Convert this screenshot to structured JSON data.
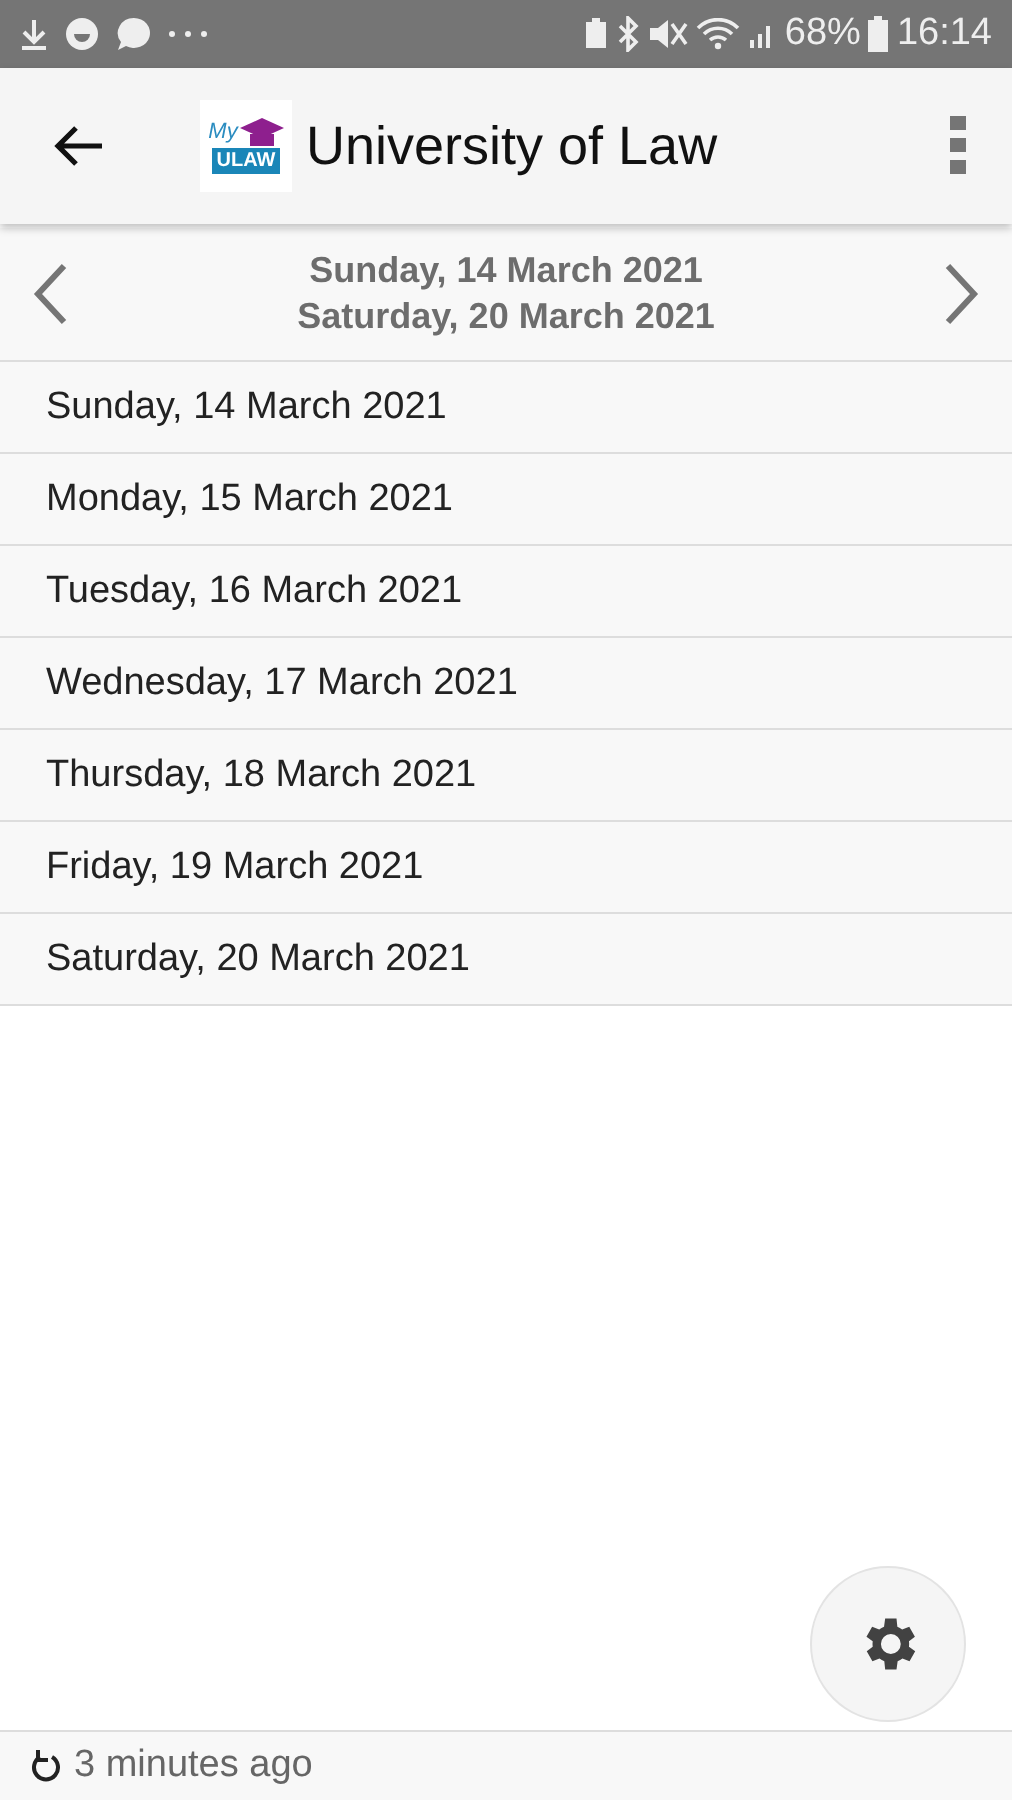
{
  "status_bar": {
    "battery": "68%",
    "time": "16:14"
  },
  "app_bar": {
    "logo_top": "My",
    "logo_bottom": "ULAW",
    "title": "University of Law"
  },
  "week_nav": {
    "start": "Sunday, 14 March 2021",
    "end": "Saturday, 20 March 2021"
  },
  "days": [
    "Sunday, 14 March 2021",
    "Monday, 15 March 2021",
    "Tuesday, 16 March 2021",
    "Wednesday, 17 March 2021",
    "Thursday, 18 March 2021",
    "Friday, 19 March 2021",
    "Saturday, 20 March 2021"
  ],
  "footer": {
    "updated": "3 minutes ago"
  }
}
